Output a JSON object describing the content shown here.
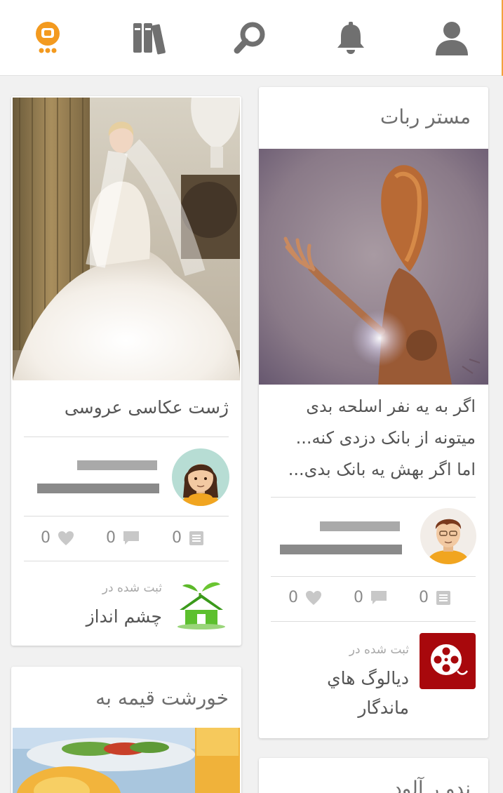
{
  "topbar": {
    "icons": [
      "app-logo-icon",
      "library-books-icon",
      "search-icon",
      "bell-icon",
      "user-icon"
    ],
    "accent": "#f39a1f"
  },
  "feed": {
    "right_column": {
      "post1": {
        "title": "مستر ربات",
        "excerpt": [
          "اگر به یه نفر اسلحه بدی",
          "میتونه از بانک دزدی کنه...",
          "اما اگر بهش یه بانک بدی..."
        ],
        "stats": {
          "notes": "0",
          "comments": "0",
          "likes": "0"
        },
        "registered_label": "ثبت شده در",
        "channel": "ديالوگ هاي ماندگار",
        "channel_color": "#a8080c"
      },
      "post3": {
        "title": "ندو ر آلود"
      }
    },
    "left_column": {
      "post2": {
        "title": "ژست عکاسی عروسی",
        "stats": {
          "notes": "0",
          "comments": "0",
          "likes": "0"
        },
        "registered_label": "ثبت شده در",
        "channel": "چشم انداز"
      },
      "post4": {
        "title": "خورشت قیمه به"
      }
    }
  }
}
